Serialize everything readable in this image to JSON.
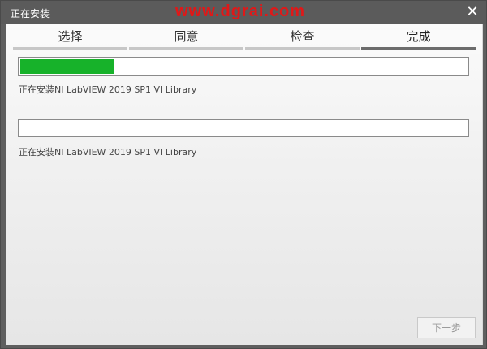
{
  "window": {
    "title": "正在安装",
    "watermark": "www.dgrai.com",
    "close_glyph": "✕"
  },
  "tabs": [
    {
      "label": "选择",
      "active": false
    },
    {
      "label": "同意",
      "active": false
    },
    {
      "label": "检查",
      "active": false
    },
    {
      "label": "完成",
      "active": true
    }
  ],
  "progress": {
    "overall": {
      "fraction": 0.21,
      "status": "正在安装NI LabVIEW 2019 SP1 VI Library"
    },
    "item": {
      "fraction": 0.0,
      "status": "正在安装NI LabVIEW 2019 SP1 VI Library"
    }
  },
  "buttons": {
    "next_label": "下一步"
  },
  "colors": {
    "progress_fill": "#17b22a",
    "watermark": "#e01818"
  }
}
